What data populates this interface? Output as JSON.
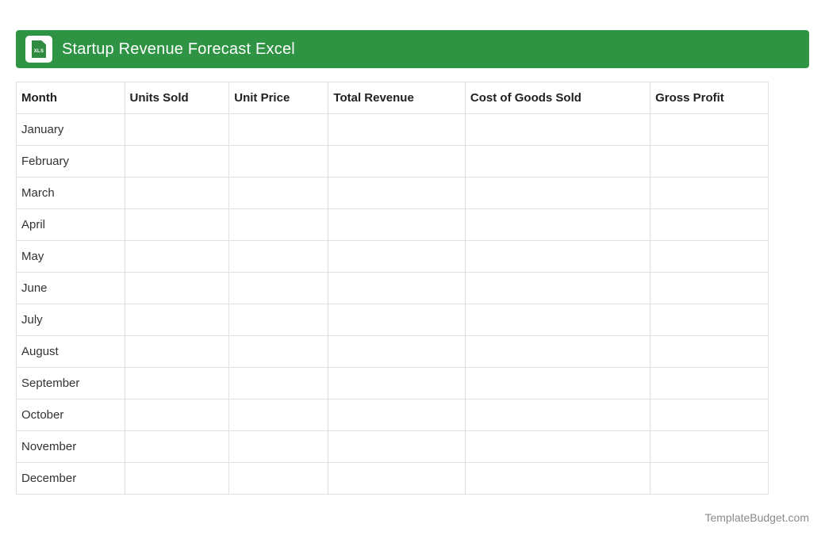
{
  "header": {
    "title": "Startup Revenue Forecast Excel",
    "icon_label": "XLS",
    "bg_color": "#2e9343"
  },
  "table": {
    "columns": [
      "Month",
      "Units Sold",
      "Unit Price",
      "Total Revenue",
      "Cost of Goods Sold",
      "Gross Profit"
    ],
    "column_widths_pct": [
      14.4,
      13.9,
      13.2,
      18.2,
      24.6,
      15.7
    ],
    "months": [
      "January",
      "February",
      "March",
      "April",
      "May",
      "June",
      "July",
      "August",
      "September",
      "October",
      "November",
      "December"
    ],
    "empty_value": ""
  },
  "footer": {
    "credit": "TemplateBudget.com"
  }
}
